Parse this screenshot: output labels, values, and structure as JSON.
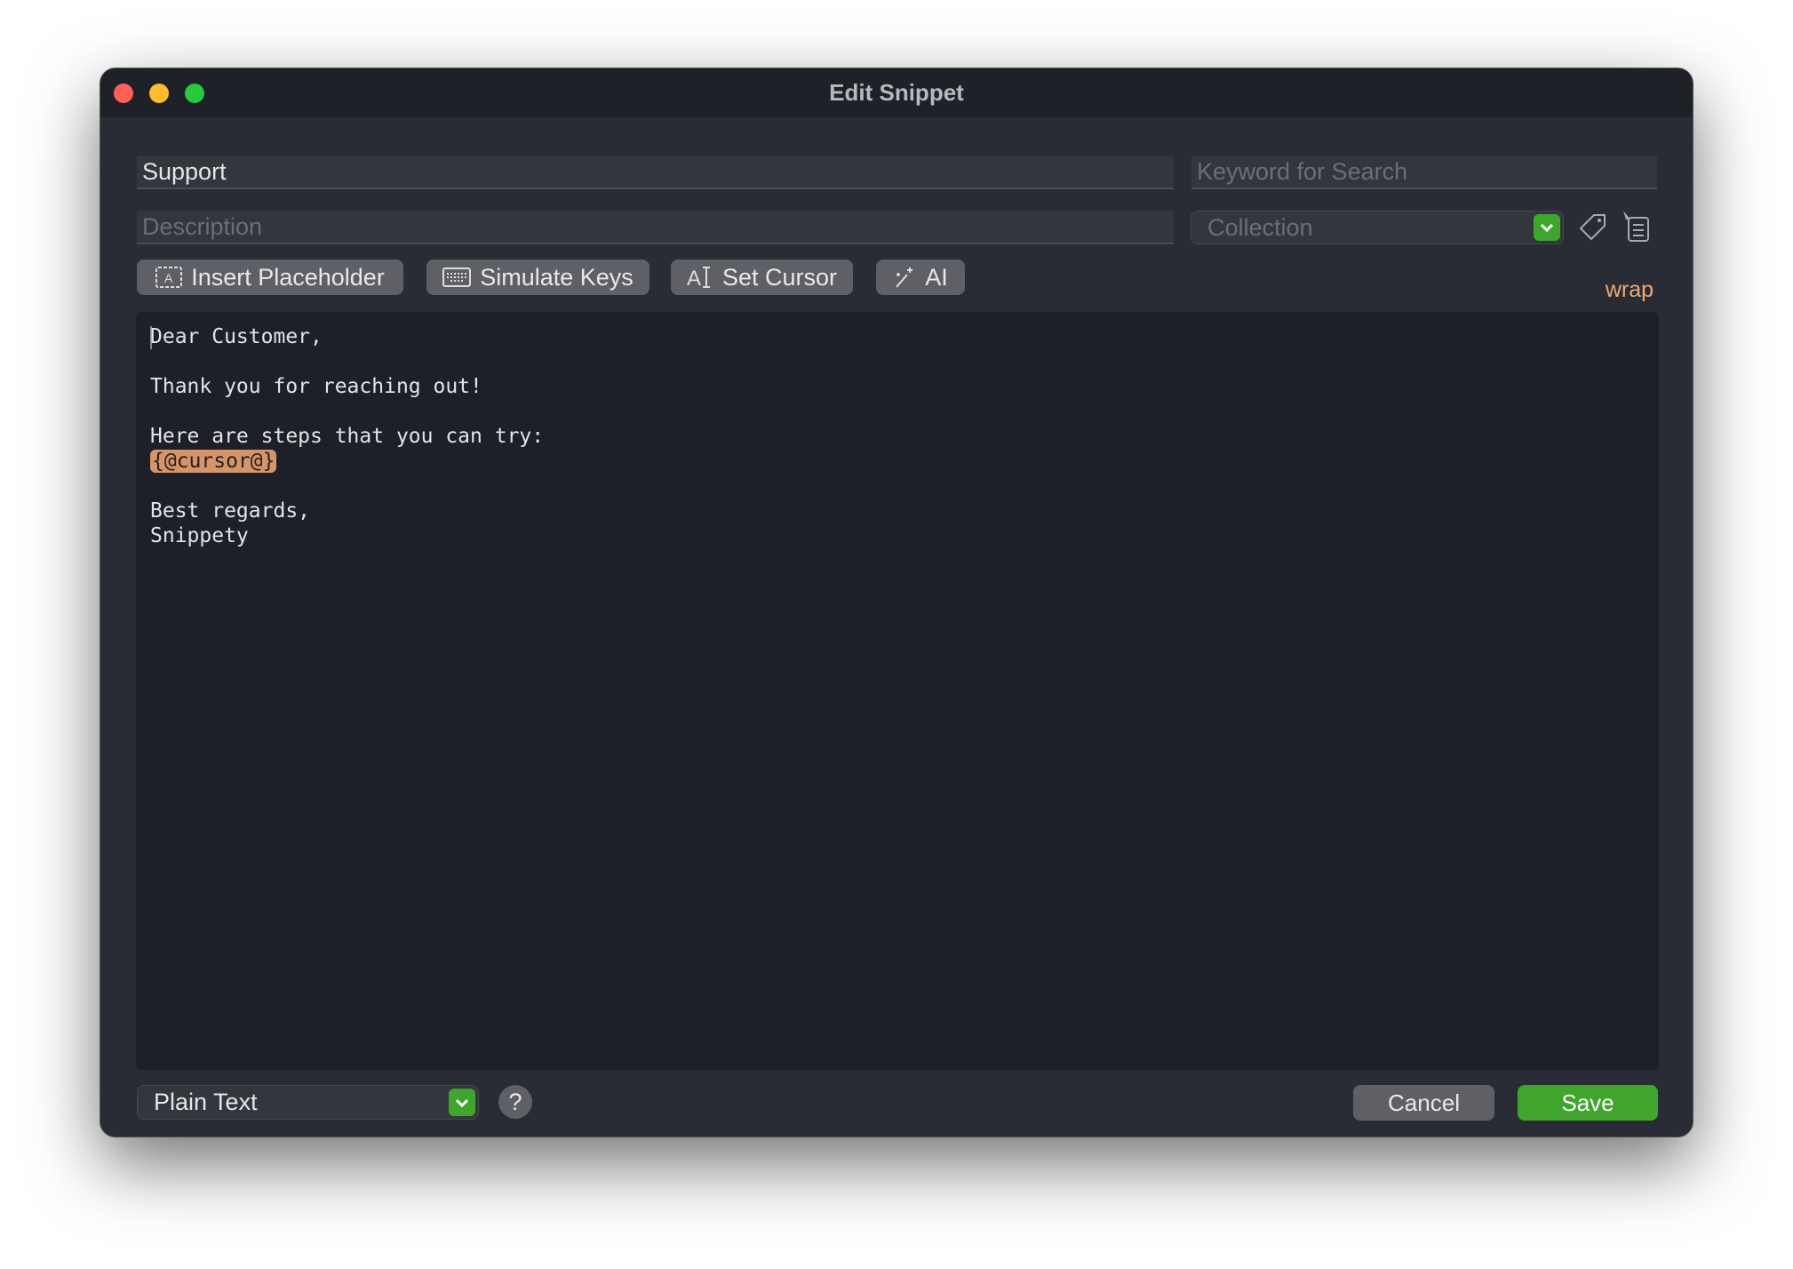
{
  "window": {
    "title": "Edit Snippet"
  },
  "form": {
    "name_value": "Support",
    "keyword_placeholder": "Keyword for Search",
    "description_placeholder": "Description",
    "collection_placeholder": "Collection"
  },
  "toolbar": {
    "insert_placeholder": "Insert Placeholder",
    "simulate_keys": "Simulate Keys",
    "set_cursor": "Set Cursor",
    "ai": "AI",
    "wrap": "wrap"
  },
  "editor": {
    "lines": [
      "Dear Customer,",
      "",
      "Thank you for reaching out!",
      "",
      "Here are steps that you can try:"
    ],
    "token": "{@cursor@}",
    "closing": [
      "",
      "Best regards,",
      "Snippety"
    ]
  },
  "footer": {
    "format": "Plain Text",
    "help": "?",
    "cancel": "Cancel",
    "save": "Save"
  },
  "colors": {
    "accent_green": "#3fa52d",
    "token": "#d4956b",
    "wrap": "#f0a878"
  }
}
